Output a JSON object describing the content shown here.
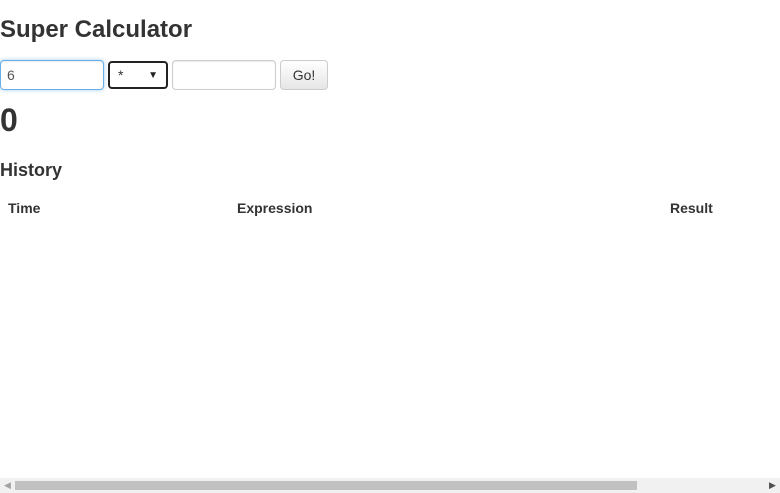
{
  "page": {
    "title": "Super Calculator"
  },
  "form": {
    "first_value": "6",
    "operator": "*",
    "second_value": "",
    "go_label": "Go!"
  },
  "result": {
    "value": "0"
  },
  "history": {
    "title": "History",
    "columns": [
      "Time",
      "Expression",
      "Result"
    ],
    "rows": []
  },
  "icons": {
    "dropdown": "chevron-down-icon",
    "scroll_left": "arrow-left-icon",
    "scroll_right": "arrow-right-icon"
  },
  "colors": {
    "focus": "#66afe9",
    "text": "#333333"
  }
}
